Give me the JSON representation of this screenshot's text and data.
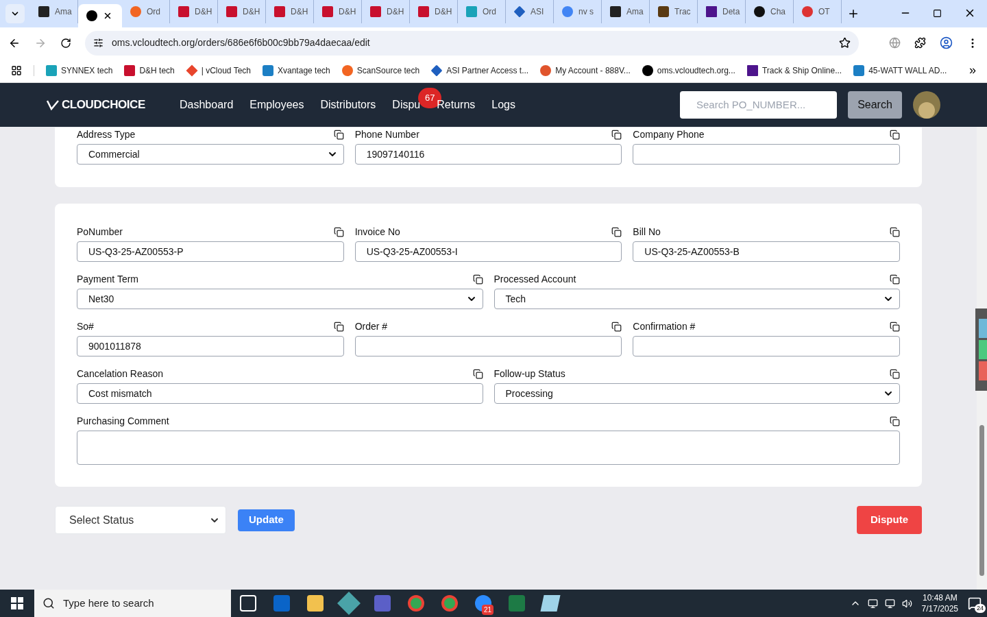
{
  "browser": {
    "tabs": [
      {
        "title": "Ama",
        "kind": "amazon",
        "selected": false
      },
      {
        "kind": "vcloud",
        "selected": true
      },
      {
        "title": "Ord",
        "kind": "scansource",
        "selected": false
      },
      {
        "title": "D&H",
        "kind": "dh",
        "selected": false
      },
      {
        "title": "D&H",
        "kind": "dh",
        "selected": false
      },
      {
        "title": "D&H",
        "kind": "dh",
        "selected": false
      },
      {
        "title": "D&H",
        "kind": "dh",
        "selected": false
      },
      {
        "title": "D&H",
        "kind": "dh",
        "selected": false
      },
      {
        "title": "D&H",
        "kind": "dh",
        "selected": false
      },
      {
        "title": "Ord",
        "kind": "ec",
        "selected": false
      },
      {
        "title": "ASI",
        "kind": "asi",
        "selected": false
      },
      {
        "title": "nv s",
        "kind": "google",
        "selected": false
      },
      {
        "title": "Ama",
        "kind": "amazon",
        "selected": false
      },
      {
        "title": "Trac",
        "kind": "ups",
        "selected": false
      },
      {
        "title": "Deta",
        "kind": "fedex",
        "selected": false
      },
      {
        "title": "Cha",
        "kind": "chat",
        "selected": false
      },
      {
        "title": "OT",
        "kind": "otm",
        "selected": false
      }
    ],
    "url": "oms.vcloudtech.org/orders/686e6f6b00c9bb79a4daecaa/edit",
    "bookmarks": [
      {
        "title": "SYNNEX tech",
        "kind": "ec"
      },
      {
        "title": "D&H tech",
        "kind": "dh"
      },
      {
        "title": "| vCloud Tech",
        "kind": "vcl"
      },
      {
        "title": "Xvantage tech",
        "kind": "xv"
      },
      {
        "title": "ScanSource tech",
        "kind": "scansource"
      },
      {
        "title": "ASI Partner Access t...",
        "kind": "asi"
      },
      {
        "title": "My Account - 888V...",
        "kind": "rings"
      },
      {
        "title": "oms.vcloudtech.org...",
        "kind": "vcloud"
      },
      {
        "title": "Track & Ship Online...",
        "kind": "fedex"
      },
      {
        "title": "45-WATT WALL AD...",
        "kind": "xv"
      }
    ],
    "more": "»"
  },
  "nav": {
    "logo": "CLOUDCHOICE",
    "links": [
      {
        "label": "Dashboard"
      },
      {
        "label": "Employees"
      },
      {
        "label": "Distributors"
      },
      {
        "label": "Dispu",
        "badge": "67"
      },
      {
        "label": "Returns"
      },
      {
        "label": "Logs"
      }
    ],
    "search": {
      "placeholder": "Search PO_NUMBER..."
    },
    "search_button": "Search"
  },
  "address_card": {
    "rows": [
      [
        {
          "label": "Address Type",
          "kind": "select",
          "value": "Commercial"
        },
        {
          "label": "Phone Number",
          "kind": "input",
          "value": "19097140116"
        },
        {
          "label": "Company Phone",
          "kind": "input"
        }
      ]
    ]
  },
  "order_card": {
    "rows": [
      [
        {
          "label": "PoNumber",
          "kind": "input",
          "value": "US-Q3-25-AZ00553-P"
        },
        {
          "label": "Invoice No",
          "kind": "input",
          "value": "US-Q3-25-AZ00553-I"
        },
        {
          "label": "Bill No",
          "kind": "input",
          "value": "US-Q3-25-AZ00553-B"
        }
      ],
      [
        {
          "label": "Payment Term",
          "kind": "select",
          "value": "Net30"
        },
        {
          "label": "Processed Account",
          "kind": "select",
          "value": "Tech"
        }
      ],
      [
        {
          "label": "So#",
          "kind": "input",
          "value": "9001011878"
        },
        {
          "label": "Order #",
          "kind": "input"
        },
        {
          "label": "Confirmation #",
          "kind": "input"
        }
      ],
      [
        {
          "label": "Cancelation Reason",
          "kind": "input",
          "value": "Cost mismatch"
        },
        {
          "label": "Follow-up Status",
          "kind": "select",
          "value": "Processing"
        }
      ],
      [
        {
          "label": "Purchasing Comment",
          "kind": "textarea"
        }
      ]
    ]
  },
  "actions": {
    "status_select": "Select Status",
    "update": "Update",
    "dispute": "Dispute"
  },
  "taskbar": {
    "search_placeholder": "Type here to search",
    "apps": [
      {
        "kind": "taskview"
      },
      {
        "kind": "outlook"
      },
      {
        "kind": "files"
      },
      {
        "kind": "gem"
      },
      {
        "kind": "teams"
      },
      {
        "kind": "chrome"
      },
      {
        "kind": "chrome"
      },
      {
        "kind": "zoom",
        "badge": "21"
      },
      {
        "kind": "excel"
      },
      {
        "kind": "notepad"
      }
    ],
    "time": "10:48 AM",
    "date": "7/17/2025",
    "notifications": "24"
  }
}
